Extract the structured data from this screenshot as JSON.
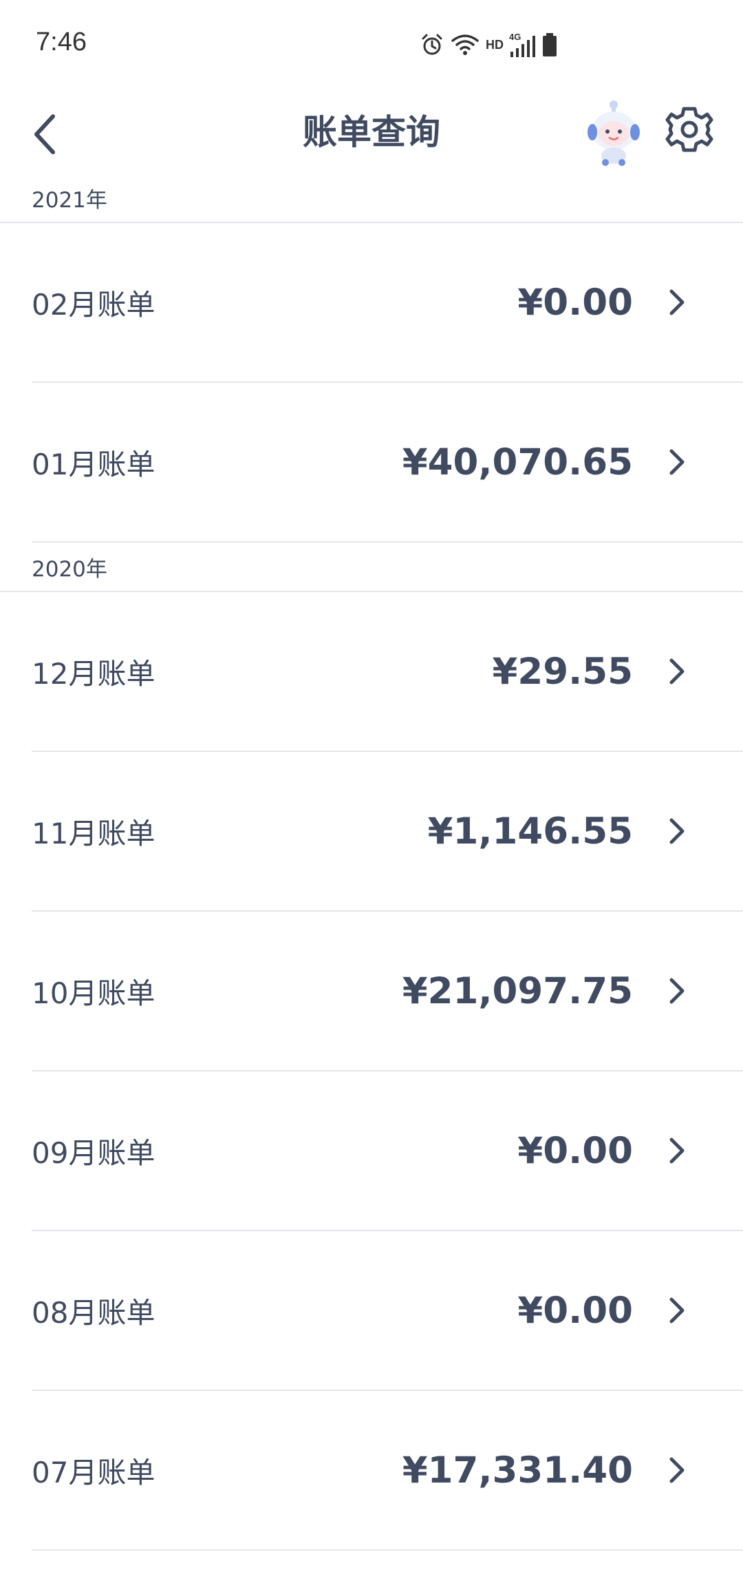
{
  "status_bar": {
    "time": "7:46",
    "hd_label": "HD",
    "network_label": "4G"
  },
  "header": {
    "title": "账单查询"
  },
  "sections": [
    {
      "year": "2021年",
      "bills": [
        {
          "label": "02月账单",
          "amount": "¥0.00"
        },
        {
          "label": "01月账单",
          "amount": "¥40,070.65"
        }
      ]
    },
    {
      "year": "2020年",
      "bills": [
        {
          "label": "12月账单",
          "amount": "¥29.55"
        },
        {
          "label": "11月账单",
          "amount": "¥1,146.55"
        },
        {
          "label": "10月账单",
          "amount": "¥21,097.75"
        },
        {
          "label": "09月账单",
          "amount": "¥0.00"
        },
        {
          "label": "08月账单",
          "amount": "¥0.00"
        },
        {
          "label": "07月账单",
          "amount": "¥17,331.40"
        }
      ]
    }
  ],
  "icons": {
    "back": "chevron-left-icon",
    "settings": "gear-icon",
    "avatar": "robot-mascot-avatar",
    "row_arrow": "chevron-right-icon"
  },
  "colors": {
    "text": "#404a60",
    "divider": "#e4e6eb",
    "background": "#ffffff"
  }
}
